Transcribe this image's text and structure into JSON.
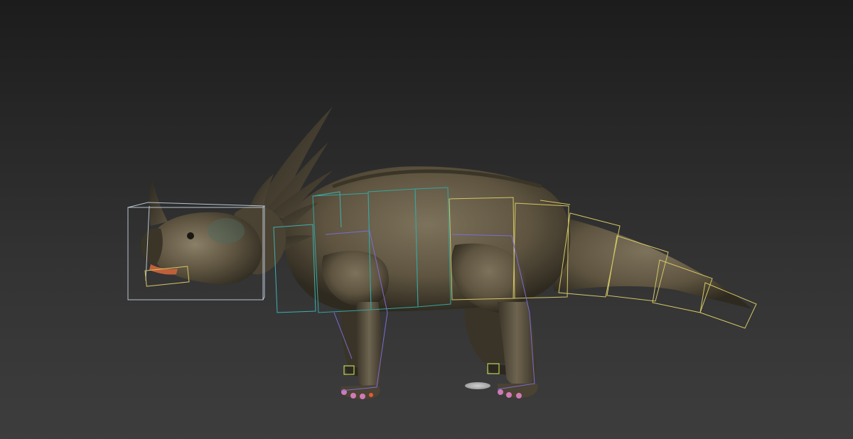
{
  "viewport": {
    "background_top": "#1c1c1c",
    "background_bottom": "#3d3d3d"
  },
  "model": {
    "kind": "styracosaurus",
    "skin_color": "#5e5440",
    "skin_highlight": "#7d735c",
    "skin_shadow": "#2f2a20",
    "horn_color": "#4a4232",
    "mouth_color": "#c0603a",
    "claw_color": "#d07ab8"
  },
  "rig": {
    "head_box_color": "#b8c4d0",
    "neck_box_color": "#40b0b0",
    "body_box_color": "#35a6a0",
    "tail_box_color": "#d4c766",
    "limb_color": "#7b6cd8",
    "foot_marker_color": "#d8f05a"
  }
}
